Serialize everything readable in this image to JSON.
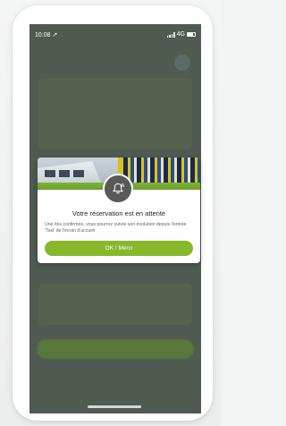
{
  "status_bar": {
    "time": "10:08 ↗",
    "network": "4G"
  },
  "modal": {
    "title": "Votre réservation est en attente",
    "body": "Une fois confirmée, vous pourrez suivre son évolution depuis l'entrée 'Taxi' de l'écran d'accueil",
    "button_label": "OK ! Merci",
    "icon": "bell-ring-icon"
  },
  "colors": {
    "accent_green": "#86b82a",
    "overlay": "#4f5a50",
    "badge_gray": "#5a5a5a"
  }
}
